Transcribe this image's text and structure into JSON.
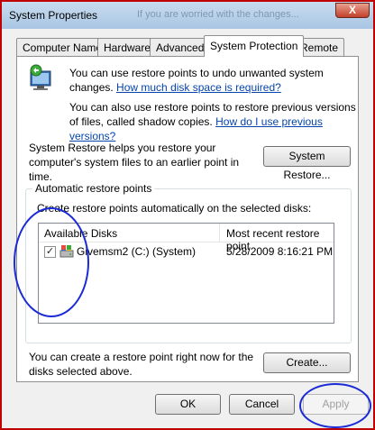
{
  "window": {
    "title": "System Properties",
    "close_glyph": "X",
    "background_text": "If you are worried with the changes..."
  },
  "tabs": [
    {
      "label": "Computer Name"
    },
    {
      "label": "Hardware"
    },
    {
      "label": "Advanced"
    },
    {
      "label": "System Protection",
      "active": true
    },
    {
      "label": "Remote"
    }
  ],
  "intro": {
    "line1_text": "You can use restore points to undo unwanted system changes.",
    "line1_link": "How much disk space is required?",
    "line2_text": "You can also use restore points to restore previous versions of files, called shadow copies.",
    "line2_link": "How do I use previous versions?"
  },
  "system_restore": {
    "description": "System Restore helps you restore your computer's system files to an earlier point in time.",
    "button_label": "System Restore..."
  },
  "auto_restore": {
    "group_label": "Automatic restore points",
    "instructions": "Create restore points automatically on the selected disks:",
    "columns": [
      "Available Disks",
      "Most recent restore point"
    ],
    "rows": [
      {
        "checked": true,
        "disk": "Givemsm2 (C:) (System)",
        "restore_point": "5/28/2009 8:16:21 PM"
      }
    ]
  },
  "create": {
    "description": "You can create a restore point right now for the disks selected above.",
    "button_label": "Create..."
  },
  "footer": {
    "ok_label": "OK",
    "cancel_label": "Cancel",
    "apply_label": "Apply"
  },
  "colors": {
    "link": "#0645ad",
    "annotation_circle": "#1a2bd6",
    "window_border": "#c00000"
  }
}
